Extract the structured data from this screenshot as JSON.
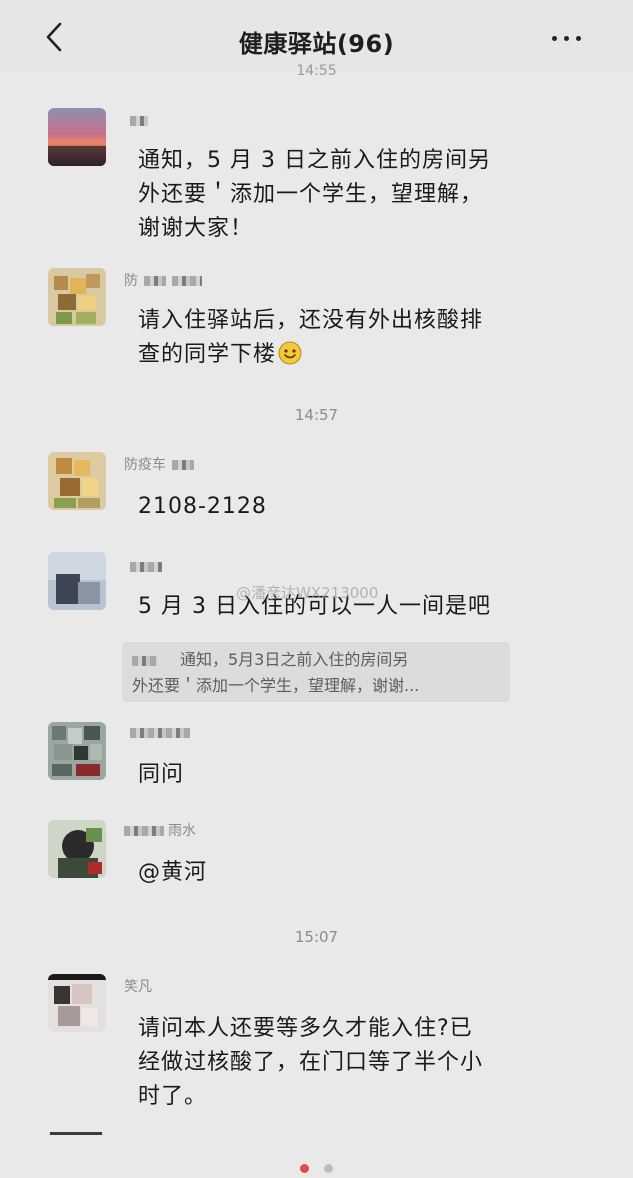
{
  "header": {
    "title": "健康驿站(96)",
    "back_icon": "chevron-left-icon",
    "more_icon": "more-horizontal-icon"
  },
  "timestamps": {
    "top_partial": "14:55",
    "t1": "14:57",
    "t2": "15:07"
  },
  "messages": [
    {
      "sender": "",
      "text_line1": "通知，5 月 3 日之前入住的房间另",
      "text_line2": "外还要＇添加一个学生，望理解，",
      "text_line3": "谢谢大家！"
    },
    {
      "sender": "防",
      "text_line1": "请入住驿站后，还没有外出核酸排",
      "text_line2": "查的同学下楼"
    },
    {
      "sender": "防疫车",
      "text_line1": "2108-2128"
    },
    {
      "sender": "",
      "text_line1": "5 月 3 日入住的可以一人一间是吧",
      "quote_line1": "通知，5月3日之前入住的房间另",
      "quote_line2": "外还要＇添加一个学生，望理解，谢谢..."
    },
    {
      "sender": "",
      "text_line1": "同问"
    },
    {
      "sender": "雨水",
      "text_line1": "@黄河"
    },
    {
      "sender": "笑凡",
      "text_line1": "请问本人还要等多久才能入住?已",
      "text_line2": "经做过核酸了，在门口等了半个小",
      "text_line3": "时了。"
    }
  ],
  "watermark": "@潘彦达WX213000",
  "pager": {
    "active_color": "#e34a4a",
    "inactive_color": "#bcbcbc"
  }
}
